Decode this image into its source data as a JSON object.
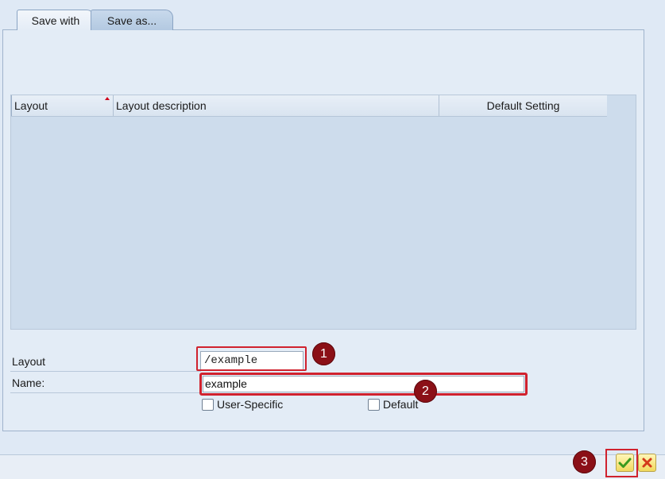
{
  "tabs": [
    {
      "label": "Save with"
    },
    {
      "label": "Save as..."
    }
  ],
  "table": {
    "columns": [
      "Layout",
      "Layout description",
      "Default Setting"
    ],
    "rows": []
  },
  "form": {
    "layout_label": "Layout",
    "layout_value": "/example",
    "name_label": "Name:",
    "name_value": "example",
    "user_specific_label": "User-Specific",
    "default_label": "Default"
  },
  "badges": [
    "1",
    "2",
    "3"
  ],
  "icons": {
    "ok": "check-icon",
    "cancel": "close-icon"
  },
  "colors": {
    "highlight": "#d0222e",
    "badge": "#8b1017",
    "ok_check": "#3a9a1f",
    "cancel_x": "#d33a1a"
  }
}
